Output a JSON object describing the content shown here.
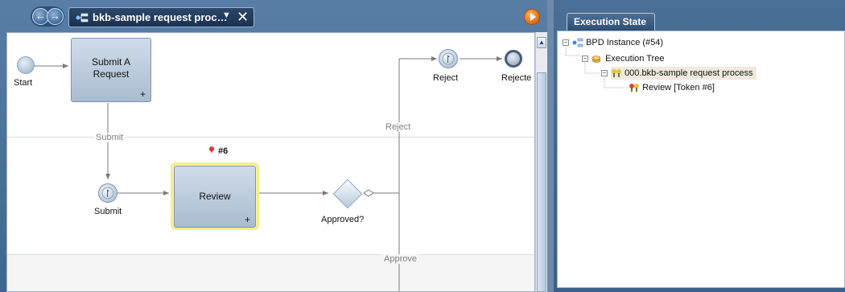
{
  "editor": {
    "tab_title": "bkb-sample request proc…",
    "nav_back": "←",
    "nav_forward": "→",
    "tab_dropdown": "▼",
    "tab_close": "✕"
  },
  "diagram": {
    "start_label": "Start",
    "task_submit_line1": "Submit A",
    "task_submit_line2": "Request",
    "task_plus": "+",
    "lane_submit": "Submit",
    "event_submit_label": "Submit",
    "task_review": "Review",
    "token_label": "#6",
    "gateway_label": "Approved?",
    "reject_flow": "Reject",
    "approve_flow": "Approve",
    "event_reject_label": "Reject",
    "end_reject_label": "Rejecte"
  },
  "execution": {
    "tab": "Execution State",
    "tree": [
      {
        "label": "BPD Instance (#54)"
      },
      {
        "label": "Execution Tree"
      },
      {
        "label": "000.bkb-sample request process"
      },
      {
        "label": "Review [Token #6]"
      }
    ],
    "collapse_symbol": "−"
  }
}
